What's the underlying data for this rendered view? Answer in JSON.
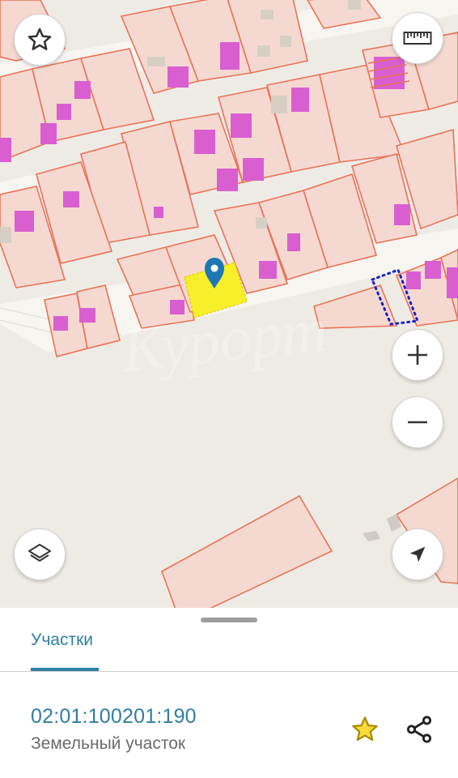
{
  "map": {
    "colors": {
      "background": "#eeebe5",
      "parcel_fill": "#f5d9d0",
      "parcel_border": "#e8735a",
      "building": "#d95fd0",
      "selected_parcel": "#f7ef2a",
      "pin": "#1f78b4",
      "road": "#f7f5f0"
    },
    "watermark": "Курорт"
  },
  "controls": {
    "favorites_icon": "star-outline-icon",
    "ruler_icon": "ruler-icon",
    "zoom_in_icon": "plus-icon",
    "zoom_out_icon": "minus-icon",
    "layers_icon": "layers-icon",
    "location_icon": "navigation-arrow-icon"
  },
  "sheet": {
    "tab_label": "Участки",
    "parcel": {
      "number": "02:01:100201:190",
      "type": "Земельный участок"
    },
    "actions": {
      "favorite_icon": "star-icon",
      "favorite_color": "#e6c21a",
      "share_icon": "share-icon"
    }
  }
}
